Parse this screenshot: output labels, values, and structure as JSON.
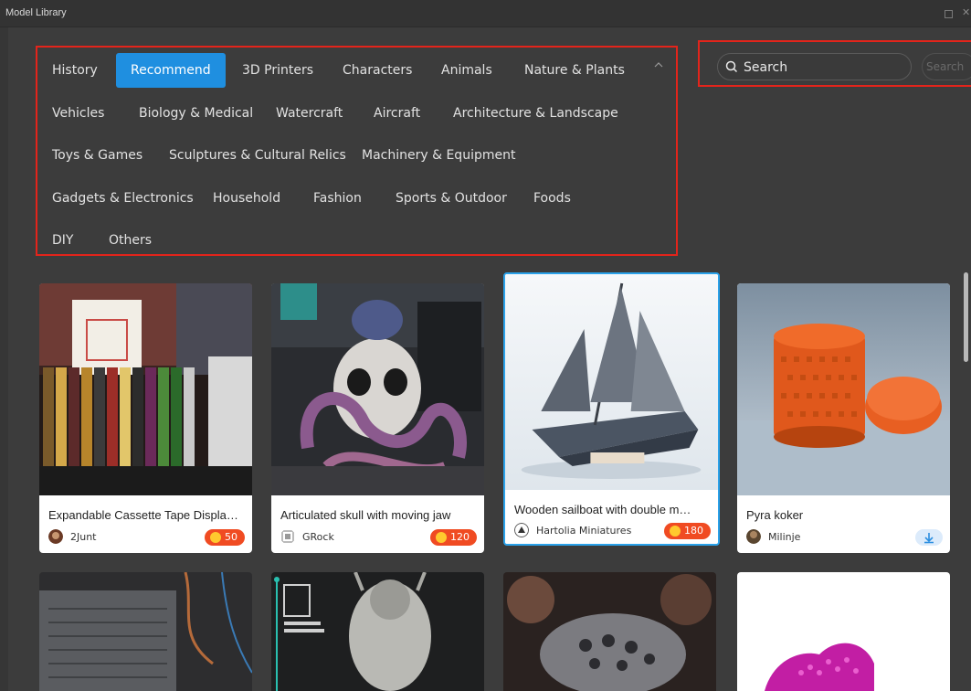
{
  "window": {
    "title": "Model Library"
  },
  "categories": [
    {
      "label": "History",
      "active": false
    },
    {
      "label": "Recommend",
      "active": true
    },
    {
      "label": "3D Printers",
      "active": false
    },
    {
      "label": "Characters",
      "active": false
    },
    {
      "label": "Animals",
      "active": false
    },
    {
      "label": "Nature & Plants",
      "active": false
    },
    {
      "label": "Vehicles",
      "active": false
    },
    {
      "label": "Biology & Medical",
      "active": false
    },
    {
      "label": "Watercraft",
      "active": false
    },
    {
      "label": "Aircraft",
      "active": false
    },
    {
      "label": "Architecture & Landscape",
      "active": false
    },
    {
      "label": "Toys & Games",
      "active": false
    },
    {
      "label": "Sculptures & Cultural Relics",
      "active": false
    },
    {
      "label": "Machinery & Equipment",
      "active": false
    },
    {
      "label": "Gadgets & Electronics",
      "active": false
    },
    {
      "label": "Household",
      "active": false
    },
    {
      "label": "Fashion",
      "active": false
    },
    {
      "label": "Sports & Outdoor",
      "active": false
    },
    {
      "label": "Foods",
      "active": false
    },
    {
      "label": "DIY",
      "active": false
    },
    {
      "label": "Others",
      "active": false
    }
  ],
  "search": {
    "placeholder": "Search",
    "button_label": "Search"
  },
  "models": [
    {
      "title": "Expandable Cassette Tape Displa…",
      "author": "2Junt",
      "price": "50",
      "selected": false,
      "download": false
    },
    {
      "title": "Articulated skull with moving jaw",
      "author": "GRock",
      "price": "120",
      "selected": false,
      "download": false
    },
    {
      "title": "Wooden sailboat with double m…",
      "author": "Hartolia Miniatures",
      "price": "180",
      "selected": true,
      "download": false
    },
    {
      "title": "Pyra koker",
      "author": "Milinje",
      "price": "",
      "selected": false,
      "download": true
    }
  ],
  "colors": {
    "accent": "#1f8fe0",
    "highlight_border": "#e3241b",
    "price_badge": "#f04b22",
    "selected_border": "#2ba2ea"
  },
  "icons": {
    "collapse": "chevron-up-icon",
    "search": "search-icon",
    "download": "download-icon",
    "coin": "coin-icon"
  }
}
